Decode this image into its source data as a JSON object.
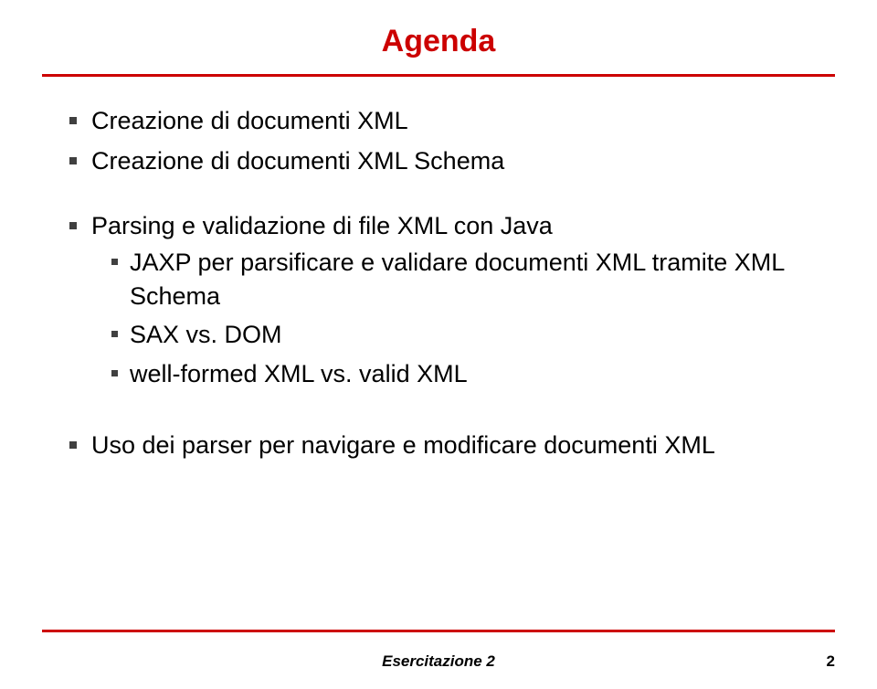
{
  "title": "Agenda",
  "bullets": {
    "b1": "Creazione di documenti XML",
    "b2": "Creazione di documenti XML Schema",
    "b3": "Parsing e validazione di file XML con Java",
    "b3_sub1": "JAXP per parsificare e validare documenti XML tramite XML Schema",
    "b3_sub2": "SAX vs. DOM",
    "b3_sub3": "well-formed XML vs. valid XML",
    "b4": "Uso dei parser per navigare e modificare documenti XML"
  },
  "footer": "Esercitazione 2",
  "page": "2"
}
